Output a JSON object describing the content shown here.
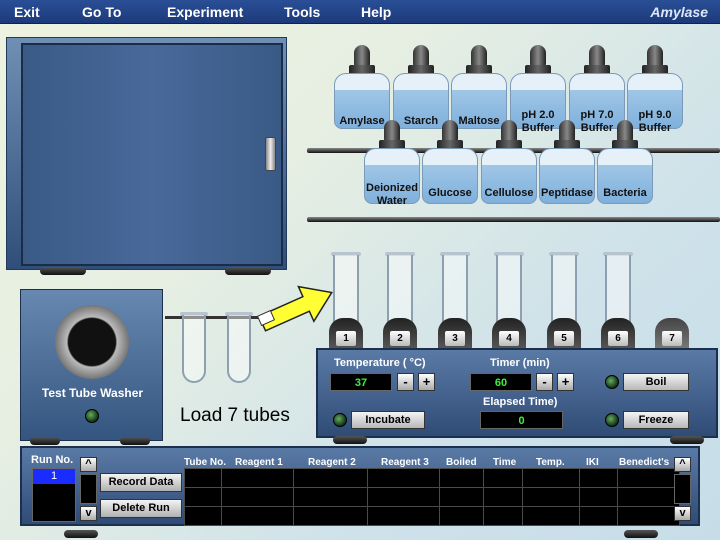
{
  "menu": {
    "exit": "Exit",
    "goto": "Go To",
    "experiment": "Experiment",
    "tools": "Tools",
    "help": "Help",
    "app_title": "Amylase"
  },
  "bottles_top": [
    {
      "label": "Amylase"
    },
    {
      "label": "Starch"
    },
    {
      "label": "Maltose"
    },
    {
      "label": "pH 2.0 Buffer"
    },
    {
      "label": "pH 7.0 Buffer"
    },
    {
      "label": "pH 9.0 Buffer"
    }
  ],
  "bottles_bottom": [
    {
      "label": "Deionized Water"
    },
    {
      "label": "Glucose"
    },
    {
      "label": "Cellulose"
    },
    {
      "label": "Peptidase"
    },
    {
      "label": "Bacteria"
    }
  ],
  "rack": {
    "slots": [
      "1",
      "2",
      "3",
      "4",
      "5",
      "6",
      "7"
    ]
  },
  "washer": {
    "label": "Test Tube Washer"
  },
  "instruction": "Load 7 tubes",
  "controls": {
    "temperature_label": "Temperature ( °C)",
    "temperature_value": "37",
    "timer_label": "Timer (min)",
    "timer_value": "60",
    "elapsed_label": "Elapsed Time)",
    "elapsed_value": "0",
    "minus": "-",
    "plus": "+",
    "boil": "Boil",
    "incubate": "Incubate",
    "freeze": "Freeze"
  },
  "data_table": {
    "run_label": "Run No.",
    "run_selected": "1",
    "record_data": "Record Data",
    "delete_run": "Delete Run",
    "up": "^",
    "down": "v",
    "columns": [
      "Tube No.",
      "Reagent 1",
      "Reagent 2",
      "Reagent 3",
      "Boiled",
      "Time",
      "Temp.",
      "IKI",
      "Benedict's"
    ]
  },
  "colors": {
    "menu_bar": "#1c3a7a",
    "panel": "#3c5c88",
    "lcd_text": "#3df03d",
    "arrow": "#ffff33"
  }
}
